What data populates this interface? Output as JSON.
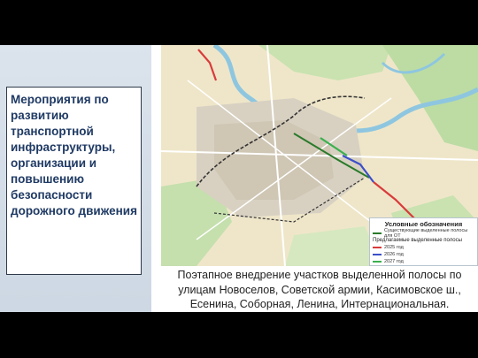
{
  "slide": {
    "title": "Мероприятия по развитию транспортной инфраструктуры, организации и повышению безопасности дорожного движения",
    "caption": "Поэтапное внедрение участков выделенной полосы по улицам Новоселов, Советской армии, Касимовское ш., Есенина, Соборная, Ленина, Интернациональная."
  },
  "legend": {
    "title": "Условные обозначения",
    "existing_label": "Существующие выделенные полосы для ОТ",
    "proposed_title": "Предлагаемые выделенные полосы",
    "items": [
      {
        "label": "2025 год",
        "color": "#d93b3b"
      },
      {
        "label": "2026 год",
        "color": "#3b4fc9"
      },
      {
        "label": "2027 год",
        "color": "#3bb04f"
      }
    ]
  },
  "colors": {
    "existing": "#2a7a2a",
    "land": "#efe6c9",
    "forest": "#b8d9a0",
    "water": "#8ec6e0"
  }
}
